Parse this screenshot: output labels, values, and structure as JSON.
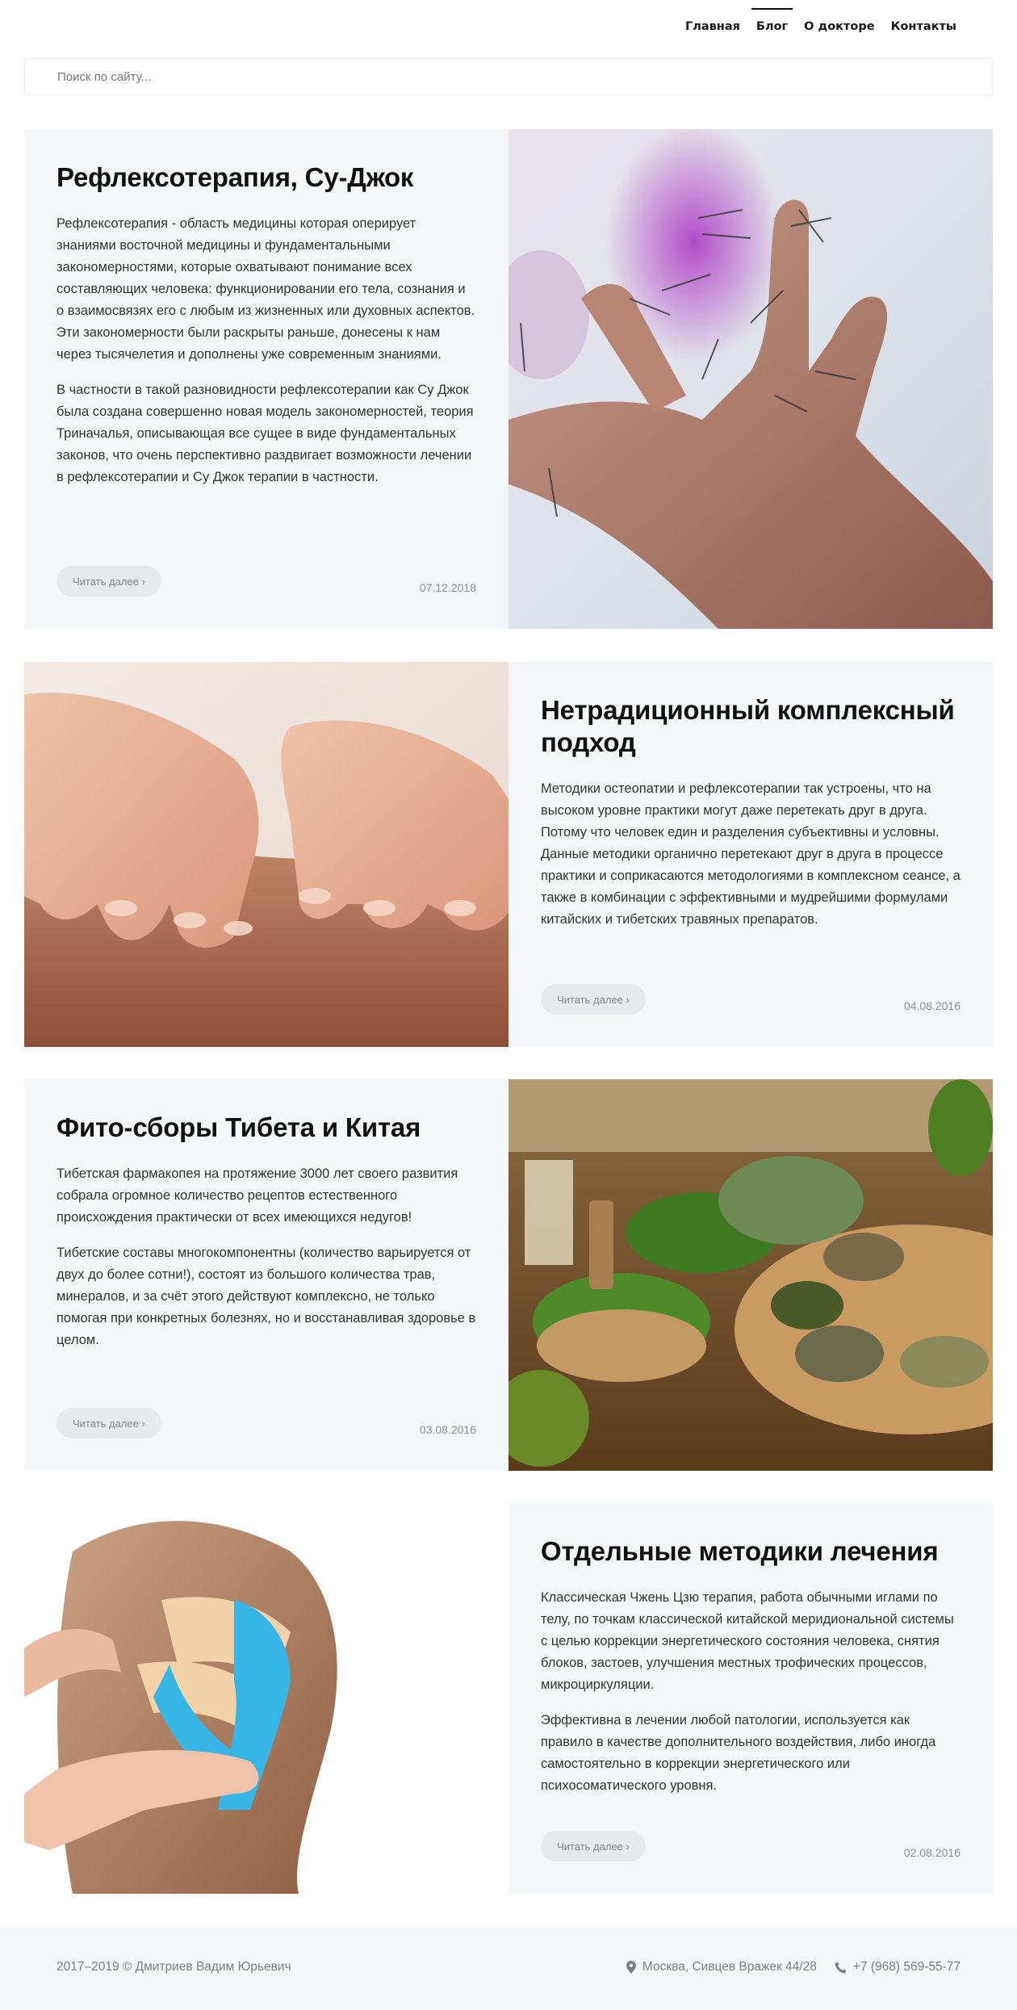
{
  "nav": {
    "items": [
      {
        "label": "Главная"
      },
      {
        "label": "Блог"
      },
      {
        "label": "О докторе"
      },
      {
        "label": "Контакты"
      }
    ]
  },
  "search": {
    "placeholder": "Поиск по сайту..."
  },
  "posts": [
    {
      "title": "Рефлексотерапия, Су-Джок",
      "paragraphs": [
        "Рефлексотерапия - область медицины которая оперирует знаниями восточной медицины и фундаментальными закономерностями, которые охватывают понимание всех составляющих человека: функционировании его тела, сознания и о взаимосвязях его с любым из жизненных или духовных аспектов. Эти закономерности были раскрыты раньше, донесены к нам через тысячелетия и дополнены уже современным знаниями.",
        "В частности в такой разновидности рефлексотерапии как Су Джок была создана совершенно новая модель закономерностей, теория Триначалья, описывающая все сущее в виде фундаментальных законов, что очень перспективно раздвигает возможности лечении в рефлексотерапии и Су Джок терапии в частности."
      ],
      "read_more": "Читать далее ›",
      "date": "07.12.2018",
      "image": "acupuncture-hand"
    },
    {
      "title": "Нетрадиционный комплексный подход",
      "paragraphs": [
        "Методики остеопатии и рефлексотерапии так устроены, что на высоком уровне практики могут даже перетекать друг в друга. Потому что человек един и разделения субъективны и условны. Данные методики органично перетекают друг в друга в процессе практики и соприкасаются методологиями в комплексном сеансе, а также в комбинации с эффективными и мудрейшими формулами китайских и тибетских травяных препаратов."
      ],
      "read_more": "Читать далее ›",
      "date": "04.08.2016",
      "image": "massage-hands"
    },
    {
      "title": "Фито-сборы Тибета и Китая",
      "paragraphs": [
        "Тибетская фармакопея на протяжение 3000 лет своего развития собрала огромное количество рецептов естественного происхождения практически от всех имеющихся недугов!",
        "Тибетские составы многокомпонентны (количество варьируется от двух до более сотни!), состоят из большого количества трав, минералов, и за счёт этого действуют комплексно, не только помогая при конкретных болезнях, но и восстанавливая здоровье в целом."
      ],
      "read_more": "Читать далее ›",
      "date": "03.08.2016",
      "image": "herbs"
    },
    {
      "title": "Отдельные методики лечения",
      "paragraphs": [
        "Классическая Чжень Цзю терапия, работа обычными иглами по телу, по точкам классической китайской меридиональной системы с целью коррекции энергетического состояния человека, снятия блоков, застоев, улучшения местных трофических процессов, микроциркуляции.",
        "Эффективна в лечении любой патологии, используется как правило в качестве дополнительного воздействия, либо иногда самостоятельно в коррекции энергетического или психосоматического уровня."
      ],
      "read_more": "Читать далее ›",
      "date": "02.08.2016",
      "image": "kinesio-tape-shoulder"
    }
  ],
  "footer": {
    "copyright": "2017–2019 © Дмитриев Вадим Юрьевич",
    "address": "Москва, Сивцев Вражек 44/28",
    "phone": "+7 (968) 569-55-77",
    "address_icon": "map-pin-icon",
    "phone_icon": "phone-icon"
  },
  "colors": {
    "card_bg": "#f5f6f8",
    "button_bg": "#e7e9ec",
    "muted_text": "#8a8f96"
  }
}
